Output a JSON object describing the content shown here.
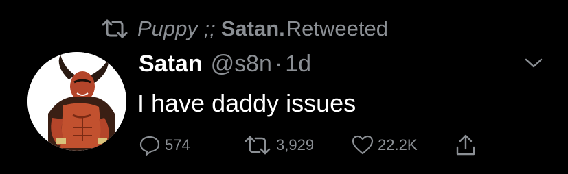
{
  "retweet_context": {
    "icon": "retweet-icon",
    "retweeter_name": "Puppy ;;",
    "retweeter_bold": "Satan.",
    "suffix": "Retweeted"
  },
  "tweet": {
    "avatar": "avatar-satan",
    "display_name": "Satan",
    "handle": "@s8n",
    "separator": "·",
    "time": "1d",
    "text": "I have daddy issues",
    "menu_icon": "chevron-down-icon"
  },
  "actions": {
    "reply": {
      "icon": "reply-icon",
      "count": "574"
    },
    "retweet": {
      "icon": "retweet-icon",
      "count": "3,929"
    },
    "like": {
      "icon": "heart-icon",
      "count": "22.2K"
    },
    "share": {
      "icon": "share-icon"
    }
  },
  "colors": {
    "background": "#000000",
    "primary_text": "#ffffff",
    "secondary_text": "#8b8f94"
  }
}
